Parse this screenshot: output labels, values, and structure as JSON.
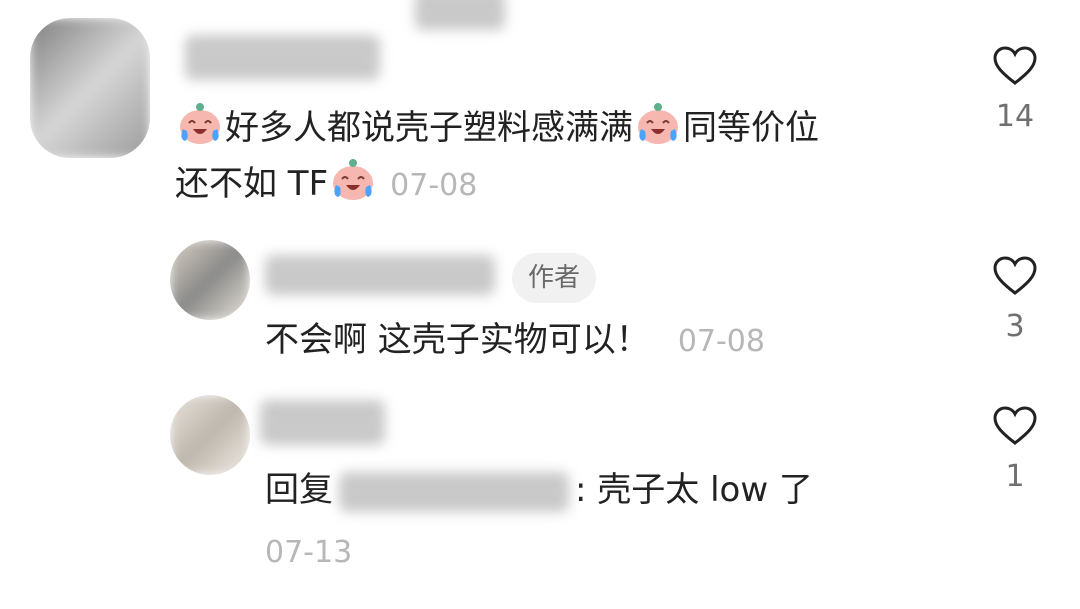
{
  "comments": [
    {
      "text_line1_a": "好多人都说壳子塑料感满满",
      "text_line1_b": "同等价位",
      "text_line2": "还不如 TF",
      "date": "07-08",
      "likes": "14",
      "emoji": "crying-laughing-emoji"
    },
    {
      "badge": "作者",
      "text": "不会啊 这壳子实物可以！",
      "date": "07-08",
      "likes": "3"
    },
    {
      "reply_prefix": "回复",
      "reply_suffix": ": 壳子太 low 了",
      "date": "07-13",
      "likes": "1"
    }
  ],
  "colors": {
    "text": "#222222",
    "date": "#b7b7b7",
    "badge_bg": "#f1f1f1"
  }
}
